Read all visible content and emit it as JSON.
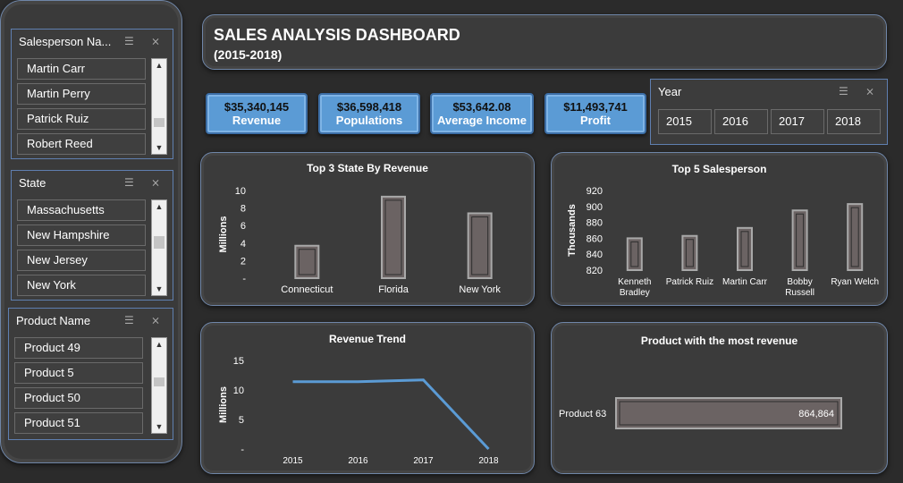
{
  "sidebar": {
    "salesperson": {
      "header": "Salesperson Na...",
      "items": [
        "Martin Carr",
        "Martin Perry",
        "Patrick Ruiz",
        "Robert Reed"
      ]
    },
    "state": {
      "header": "State",
      "items": [
        "Massachusetts",
        "New Hampshire",
        "New Jersey",
        "New York"
      ]
    },
    "product": {
      "header": "Product Name",
      "items": [
        "Product 49",
        "Product 5",
        "Product 50",
        "Product 51"
      ]
    }
  },
  "title": {
    "main": "SALES ANALYSIS DASHBOARD",
    "sub": "(2015-2018)"
  },
  "kpis": [
    {
      "value": "$35,340,145",
      "label": "Revenue"
    },
    {
      "value": "$36,598,418",
      "label": "Populations"
    },
    {
      "value": "$53,642.08",
      "label": "Average Income"
    },
    {
      "value": "$11,493,741",
      "label": "Profit"
    }
  ],
  "year_slicer": {
    "header": "Year",
    "items": [
      "2015",
      "2016",
      "2017",
      "2018"
    ]
  },
  "colors": {
    "kpi_fill": "#5b9bd5",
    "bar_fill": "#6b6363",
    "line": "#5b9bd5",
    "panel_border": "#6f86a8"
  },
  "chart_data": [
    {
      "type": "bar",
      "title": "Top 3 State By Revenue",
      "ylabel": "Millions",
      "categories": [
        "Connecticut",
        "Florida",
        "New York"
      ],
      "values": [
        3.7,
        9.3,
        7.4
      ],
      "ylim": [
        0,
        10
      ],
      "yticks": [
        "-",
        "2",
        "4",
        "6",
        "8",
        "10"
      ]
    },
    {
      "type": "bar",
      "title": "Top 5 Salesperson",
      "ylabel": "Thousands",
      "categories": [
        "Kenneth Bradley",
        "Patrick Ruiz",
        "Martin Carr",
        "Bobby Russell",
        "Ryan Welch"
      ],
      "values": [
        860,
        863,
        873,
        895,
        903
      ],
      "ylim": [
        820,
        920
      ],
      "yticks": [
        "820",
        "840",
        "860",
        "880",
        "900",
        "920"
      ]
    },
    {
      "type": "line",
      "title": "Revenue Trend",
      "ylabel": "Millions",
      "x": [
        "2015",
        "2016",
        "2017",
        "2018"
      ],
      "values": [
        11.4,
        11.4,
        11.7,
        0
      ],
      "ylim": [
        0,
        15
      ],
      "yticks": [
        "-",
        "5",
        "10",
        "15"
      ]
    },
    {
      "type": "bar",
      "title": "Product  with the most revenue",
      "categories": [
        "Product 63"
      ],
      "values": [
        864864
      ],
      "value_labels": [
        "864,864"
      ]
    }
  ]
}
